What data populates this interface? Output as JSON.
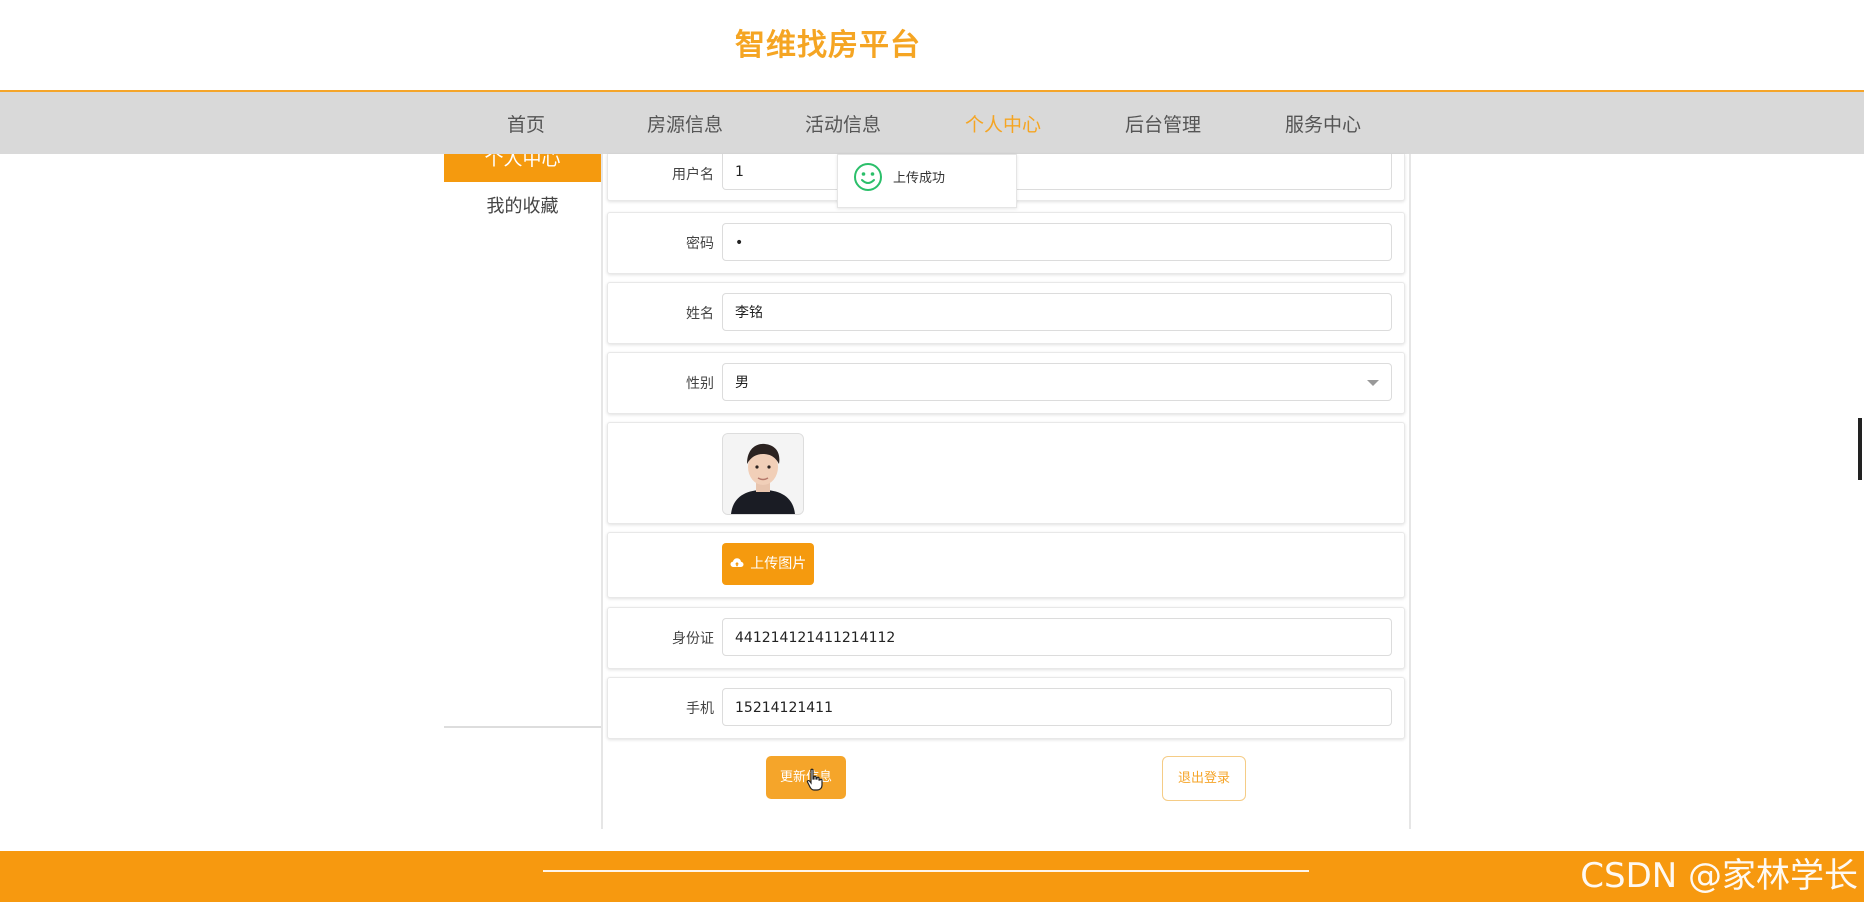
{
  "header": {
    "brand": "智维找房平台"
  },
  "nav": {
    "items": [
      {
        "label": "首页",
        "active": false
      },
      {
        "label": "房源信息",
        "active": false
      },
      {
        "label": "活动信息",
        "active": false
      },
      {
        "label": "个人中心",
        "active": true
      },
      {
        "label": "后台管理",
        "active": false
      },
      {
        "label": "服务中心",
        "active": false
      }
    ]
  },
  "sidebar": {
    "items": [
      {
        "label": "个人中心",
        "active": true
      },
      {
        "label": "我的收藏",
        "active": false
      }
    ]
  },
  "form": {
    "username": {
      "label": "用户名",
      "value": "1"
    },
    "password": {
      "label": "密码",
      "value": "•"
    },
    "name": {
      "label": "姓名",
      "value": "李铭"
    },
    "gender": {
      "label": "性别",
      "value": "男"
    },
    "upload": {
      "label": "上传图片"
    },
    "id_card": {
      "label": "身份证",
      "value": "441214121411214112"
    },
    "phone": {
      "label": "手机",
      "value": "15214121411"
    }
  },
  "buttons": {
    "update": "更新信息",
    "logout": "退出登录"
  },
  "toast": {
    "text": "上传成功"
  },
  "watermark": "CSDN @家林学长",
  "colors": {
    "accent": "#f5a523",
    "footer": "#f7990f",
    "nav_bg": "#d9d9d9",
    "success": "#2bbf6a"
  }
}
